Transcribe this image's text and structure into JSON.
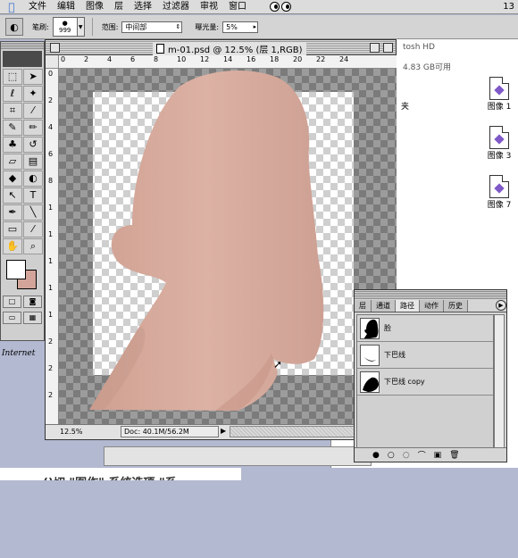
{
  "menubar": {
    "items": [
      "文件",
      "编辑",
      "图像",
      "层",
      "选择",
      "过滤器",
      "审视",
      "窗口"
    ],
    "clock": "13"
  },
  "options": {
    "brush_label": "笔刷:",
    "brush_size": "999",
    "range_label": "范围:",
    "range_value": "中间部",
    "exposure_label": "曝光量:",
    "exposure_value": "5%"
  },
  "finder": {
    "hd_name": "tosh HD",
    "hd_free": "4.83 GB可用",
    "fragment": "夹",
    "files": [
      "图像 1",
      "图像 3",
      "图像 7"
    ]
  },
  "document": {
    "title": "m-01.psd @ 12.5% (层 1,RGB)",
    "zoom": "12.5%",
    "doc_size": "Doc: 40.1M/56.2M",
    "ruler_h": [
      "0",
      "2",
      "4",
      "6",
      "8",
      "10",
      "12",
      "14",
      "16",
      "18",
      "20",
      "22",
      "24"
    ],
    "ruler_v": [
      "0",
      "2",
      "4",
      "6",
      "8",
      "1",
      "1",
      "1",
      "1",
      "1",
      "2",
      "2",
      "2"
    ]
  },
  "paths_palette": {
    "tabs": [
      "层",
      "通道",
      "路径",
      "动作",
      "历史"
    ],
    "active_tab": "路径",
    "rows": [
      "脸",
      "下巴线",
      "下巴线 copy"
    ]
  },
  "tools": {
    "icons": [
      "marquee-icon",
      "move-icon",
      "lasso-icon",
      "magic-wand-icon",
      "crop-icon",
      "slice-icon",
      "brush-icon",
      "pencil-icon",
      "stamp-icon",
      "history-brush-icon",
      "eraser-icon",
      "gradient-icon",
      "blur-icon",
      "dodge-icon",
      "path-select-icon",
      "type-icon",
      "pen-icon",
      "line-icon",
      "notes-icon",
      "eyedropper-icon",
      "hand-icon",
      "zoom-icon"
    ],
    "foreground_color": "#ffffff",
    "background_color": "#d3a59a"
  },
  "side_label": "Internet",
  "caption": "()切 \"图作\" 系统选项 \"系",
  "colors": {
    "skin": "#d4a99b",
    "skin_shadow": "#c4978a",
    "checker_dark": "#808080",
    "checker_light": "#c8c8c8",
    "desktop": "#b3b9d1"
  }
}
